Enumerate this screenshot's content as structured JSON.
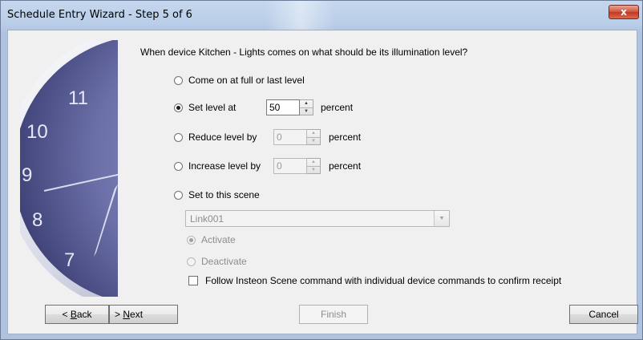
{
  "window": {
    "title": "Schedule Entry Wizard - Step 5 of 6",
    "close_glyph": "x"
  },
  "artwork": {
    "icon": "wall-clock",
    "numerals": [
      "11",
      "10",
      "9",
      "8",
      "7"
    ]
  },
  "question": "When device Kitchen - Lights comes on what should be its illumination level?",
  "options": {
    "full": {
      "label": "Come on at full or last level",
      "checked": false
    },
    "set": {
      "label": "Set level at",
      "value": "50",
      "unit": "percent",
      "checked": true
    },
    "reduce": {
      "label": "Reduce level by",
      "value": "0",
      "unit": "percent",
      "checked": false
    },
    "increase": {
      "label": "Increase level by",
      "value": "0",
      "unit": "percent",
      "checked": false
    },
    "scene": {
      "label": "Set to this scene",
      "checked": false
    }
  },
  "scene": {
    "selected": "Link001",
    "activate_label": "Activate",
    "deactivate_label": "Deactivate"
  },
  "follow_checkbox": {
    "label": "Follow Insteon Scene command with individual device commands to confirm receipt",
    "checked": false
  },
  "buttons": {
    "back_prefix": "< ",
    "back_key": "B",
    "back_rest": "ack",
    "next_prefix": "> ",
    "next_key": "N",
    "next_rest": "ext",
    "finish": "Finish",
    "cancel": "Cancel"
  },
  "colors": {
    "clock_face": "#5e6399",
    "title_bar": "#b9cde8",
    "close_button": "#c2381f"
  }
}
